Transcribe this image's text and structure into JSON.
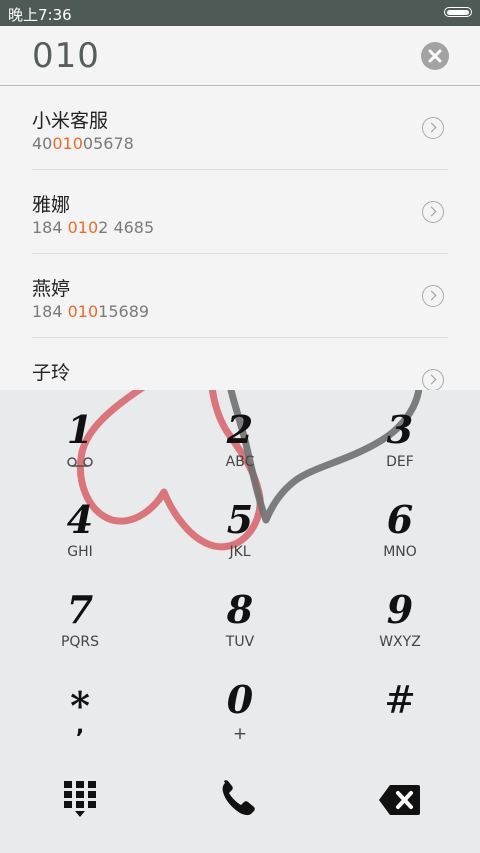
{
  "status_bar": {
    "time": "晚上7:36"
  },
  "dialer": {
    "number": "010"
  },
  "contacts": [
    {
      "name": "小米客服",
      "num_pre": "40",
      "num_match": "010",
      "num_post": "05678"
    },
    {
      "name": "雅娜",
      "num_pre": "184 ",
      "num_match": "010",
      "num_post": "2 4685"
    },
    {
      "name": "燕婷",
      "num_pre": "184 ",
      "num_match": "010",
      "num_post": "15689"
    },
    {
      "name": "子玲",
      "num_pre": "",
      "num_match": "",
      "num_post": ""
    }
  ],
  "keypad": [
    {
      "digit": "1",
      "letters": ""
    },
    {
      "digit": "2",
      "letters": "ABC"
    },
    {
      "digit": "3",
      "letters": "DEF"
    },
    {
      "digit": "4",
      "letters": "GHI"
    },
    {
      "digit": "5",
      "letters": "JKL"
    },
    {
      "digit": "6",
      "letters": "MNO"
    },
    {
      "digit": "7",
      "letters": "PQRS"
    },
    {
      "digit": "8",
      "letters": "TUV"
    },
    {
      "digit": "9",
      "letters": "WXYZ"
    },
    {
      "digit": "*",
      "letters": ","
    },
    {
      "digit": "0",
      "letters": "+"
    },
    {
      "digit": "#",
      "letters": ""
    }
  ],
  "icons": {
    "clear": "clear-icon",
    "keypad_toggle": "dialpad-icon",
    "call": "phone-icon",
    "backspace": "backspace-icon",
    "voicemail": "voicemail-icon"
  },
  "colors": {
    "match_highlight": "#ef6a2b",
    "status_bar": "#4d5a55",
    "heart_red": "#d86a72",
    "heart_gray": "#6a6a6a"
  }
}
